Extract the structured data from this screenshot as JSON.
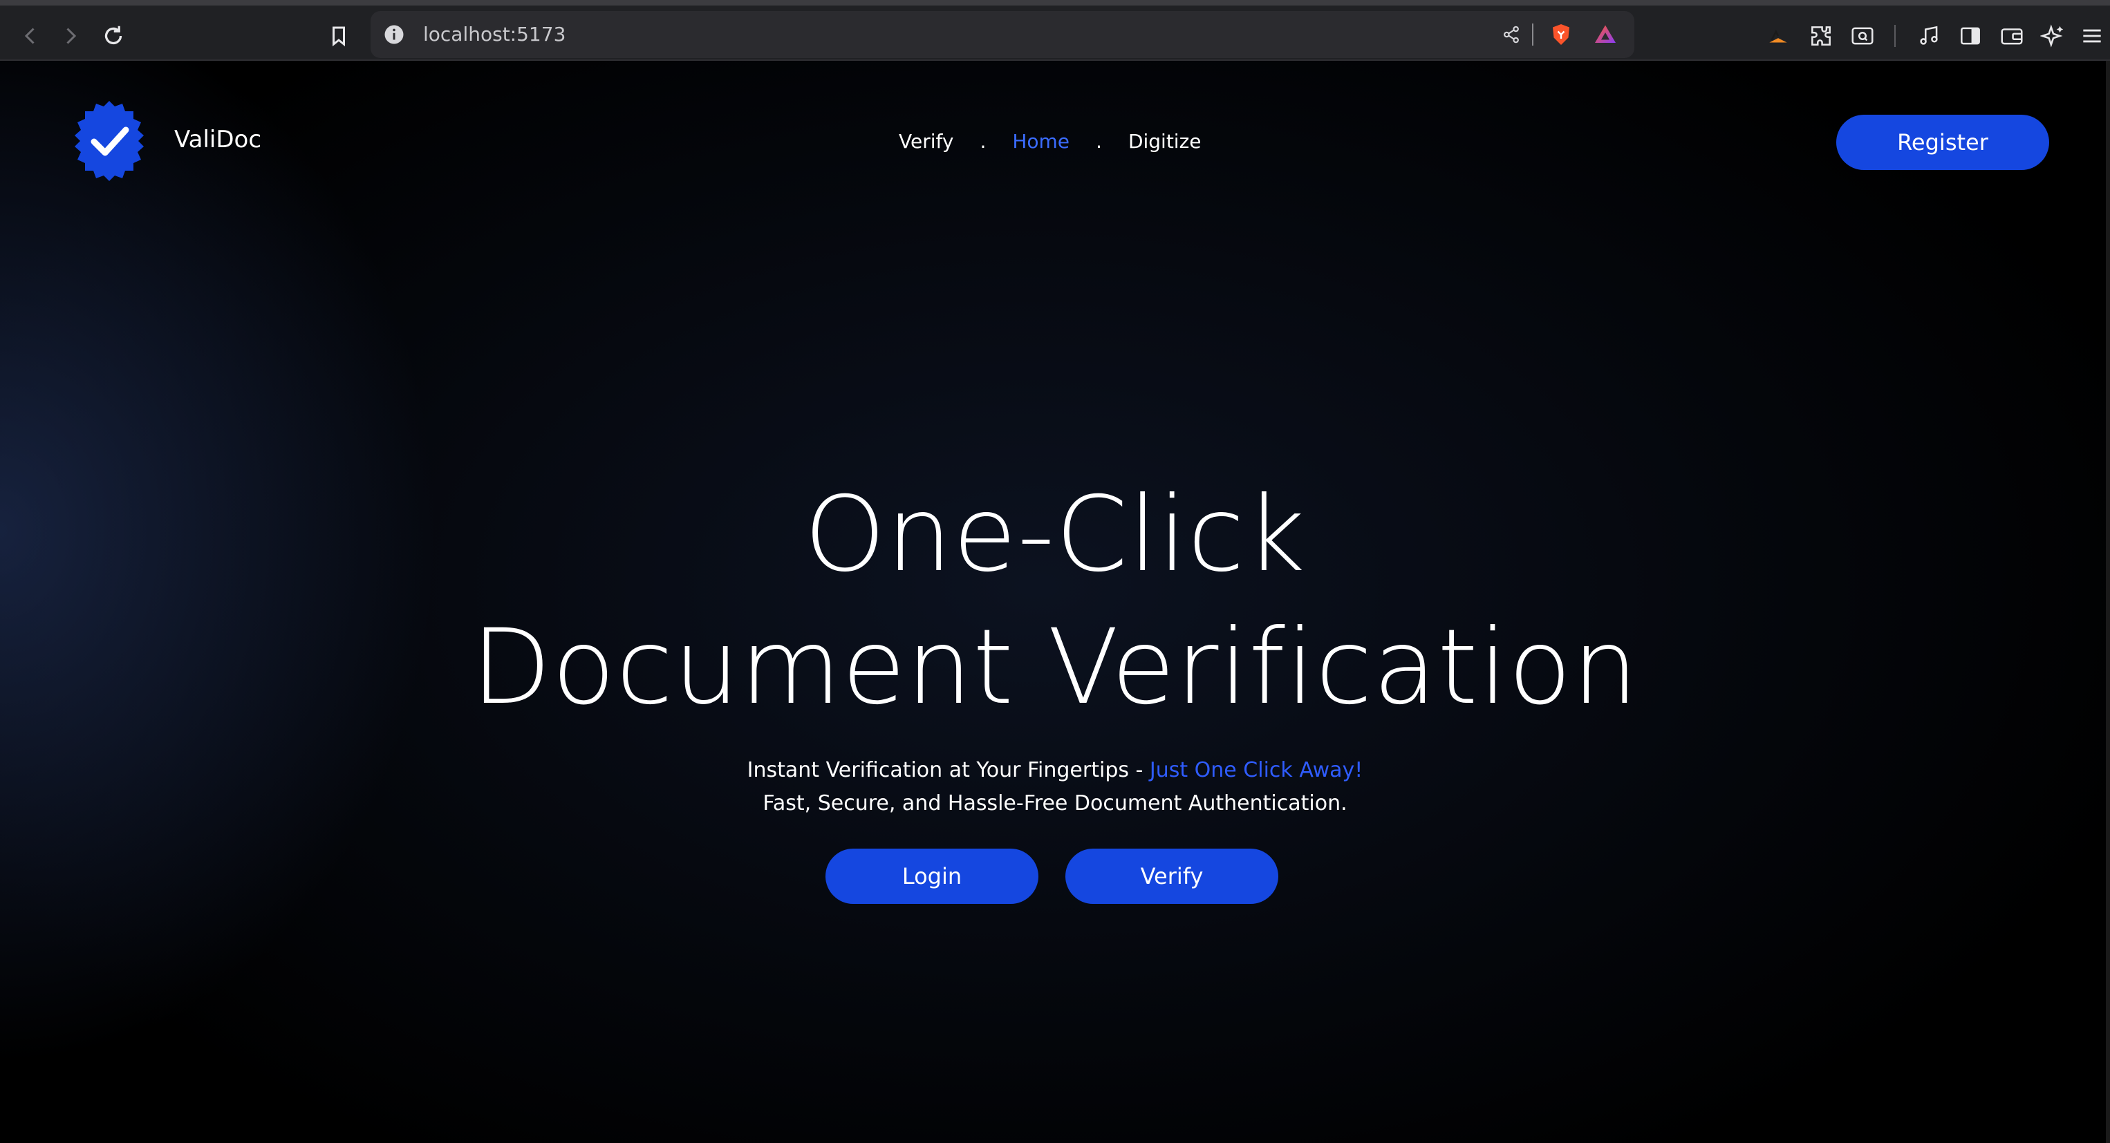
{
  "browser": {
    "url": "localhost:5173",
    "icons": [
      "back-icon",
      "forward-icon",
      "reload-icon",
      "bookmark-icon",
      "site-info-icon",
      "share-icon",
      "brave-shields-icon",
      "brave-rewards-icon",
      "leo-icon",
      "extensions-icon",
      "tab-search-icon",
      "media-icon",
      "sidebar-icon",
      "wallet-icon",
      "ai-chat-icon",
      "menu-icon"
    ]
  },
  "header": {
    "brand": "ValiDoc",
    "nav": {
      "verify": "Verify",
      "separator": ".",
      "home": "Home",
      "digitize": "Digitize"
    },
    "register_label": "Register"
  },
  "hero": {
    "title_line1": "One-Click",
    "title_line2": "Document Verification",
    "subtitle_prefix": "Instant Verification at Your Fingertips - ",
    "subtitle_highlight": "Just One Click Away!",
    "subtitle_line2": "Fast, Secure, and Hassle-Free Document Authentication.",
    "login_label": "Login",
    "verify_label": "Verify"
  },
  "colors": {
    "accent": "#1547e0",
    "active_link": "#3b6cff",
    "highlight": "#2f5cff",
    "background": "#000000"
  }
}
